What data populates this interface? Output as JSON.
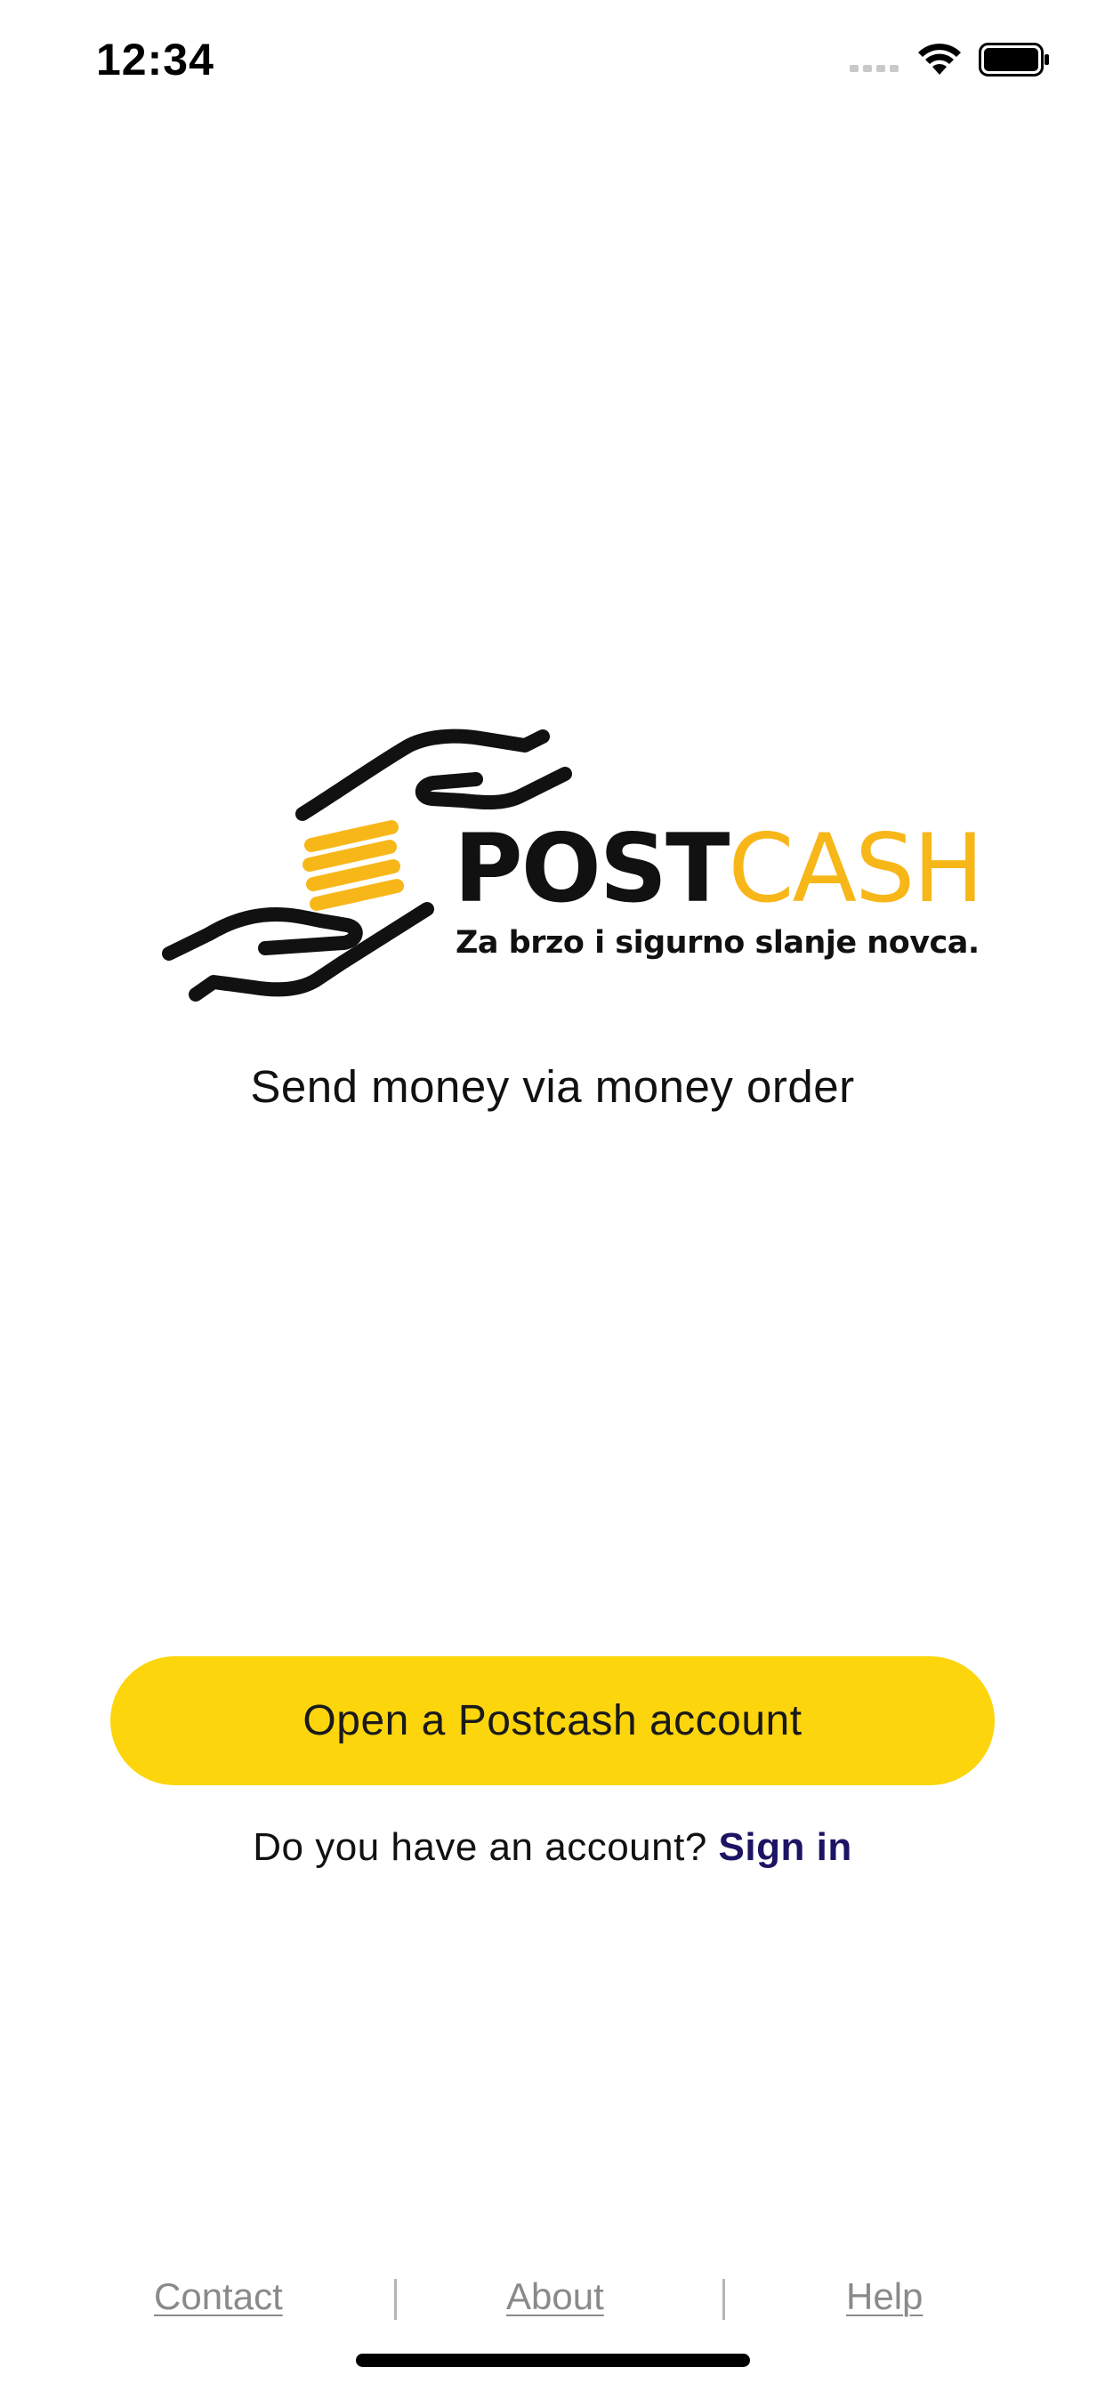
{
  "status_bar": {
    "time": "12:34",
    "signal_icon": "cellular-signal-icon",
    "wifi_icon": "wifi-icon",
    "battery_icon": "battery-icon"
  },
  "logo": {
    "word_post": "POST",
    "word_cash": "CASH",
    "tagline": "Za brzo i sigurno slanje novca.",
    "icon": "hands-coins-logo-icon",
    "colors": {
      "dark": "#111111",
      "accent": "#f7b719"
    }
  },
  "subtitle": "Send money via money order",
  "primary_button": {
    "label": "Open a Postcash account",
    "color": "#fdd50c"
  },
  "signin": {
    "prompt": "Do you have an account?",
    "link_label": "Sign in",
    "link_color": "#1b1464"
  },
  "footer": {
    "contact": "Contact",
    "about": "About",
    "help": "Help"
  }
}
